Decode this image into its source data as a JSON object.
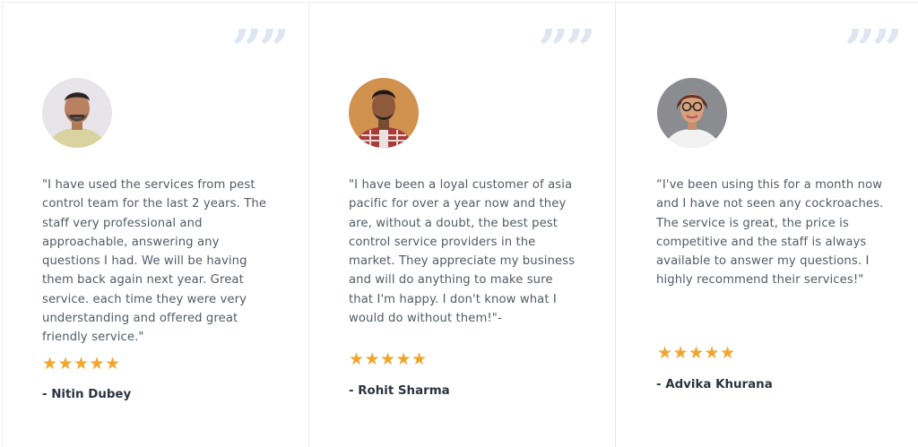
{
  "testimonials": [
    {
      "review": "\"I have used the services from pest control team for the last 2 years. The staff very professional and approachable, answering any questions I had. We will be having them back again next year. Great service. each time they were very understanding and offered great friendly service.\"",
      "author": "- Nitin Dubey",
      "rating": 5
    },
    {
      "review": "\"I have been a loyal customer of asia pacific for over a year now and they are, without a doubt, the best pest control service providers in the market. They appreciate my business and will do anything to make sure that I'm happy. I don't know what I would do without them!\"-",
      "author": "- Rohit Sharma",
      "rating": 5
    },
    {
      "review": "“I've been using this for a month now and I have not seen any cockroaches. The service is great, the price is competitive and the staff is always available to answer my questions. I highly recommend their services!\"",
      "author": "- Advika Khurana",
      "rating": 5
    }
  ],
  "icons": {
    "quote": "quote-icon",
    "star": "star-icon",
    "star_glyph": "★",
    "quote_glyph": "”"
  },
  "colors": {
    "star": "#f1a52c",
    "quote_mark": "#dfe6f1",
    "text": "#555a66",
    "author": "#2e3340",
    "card_border": "#ececf0"
  }
}
